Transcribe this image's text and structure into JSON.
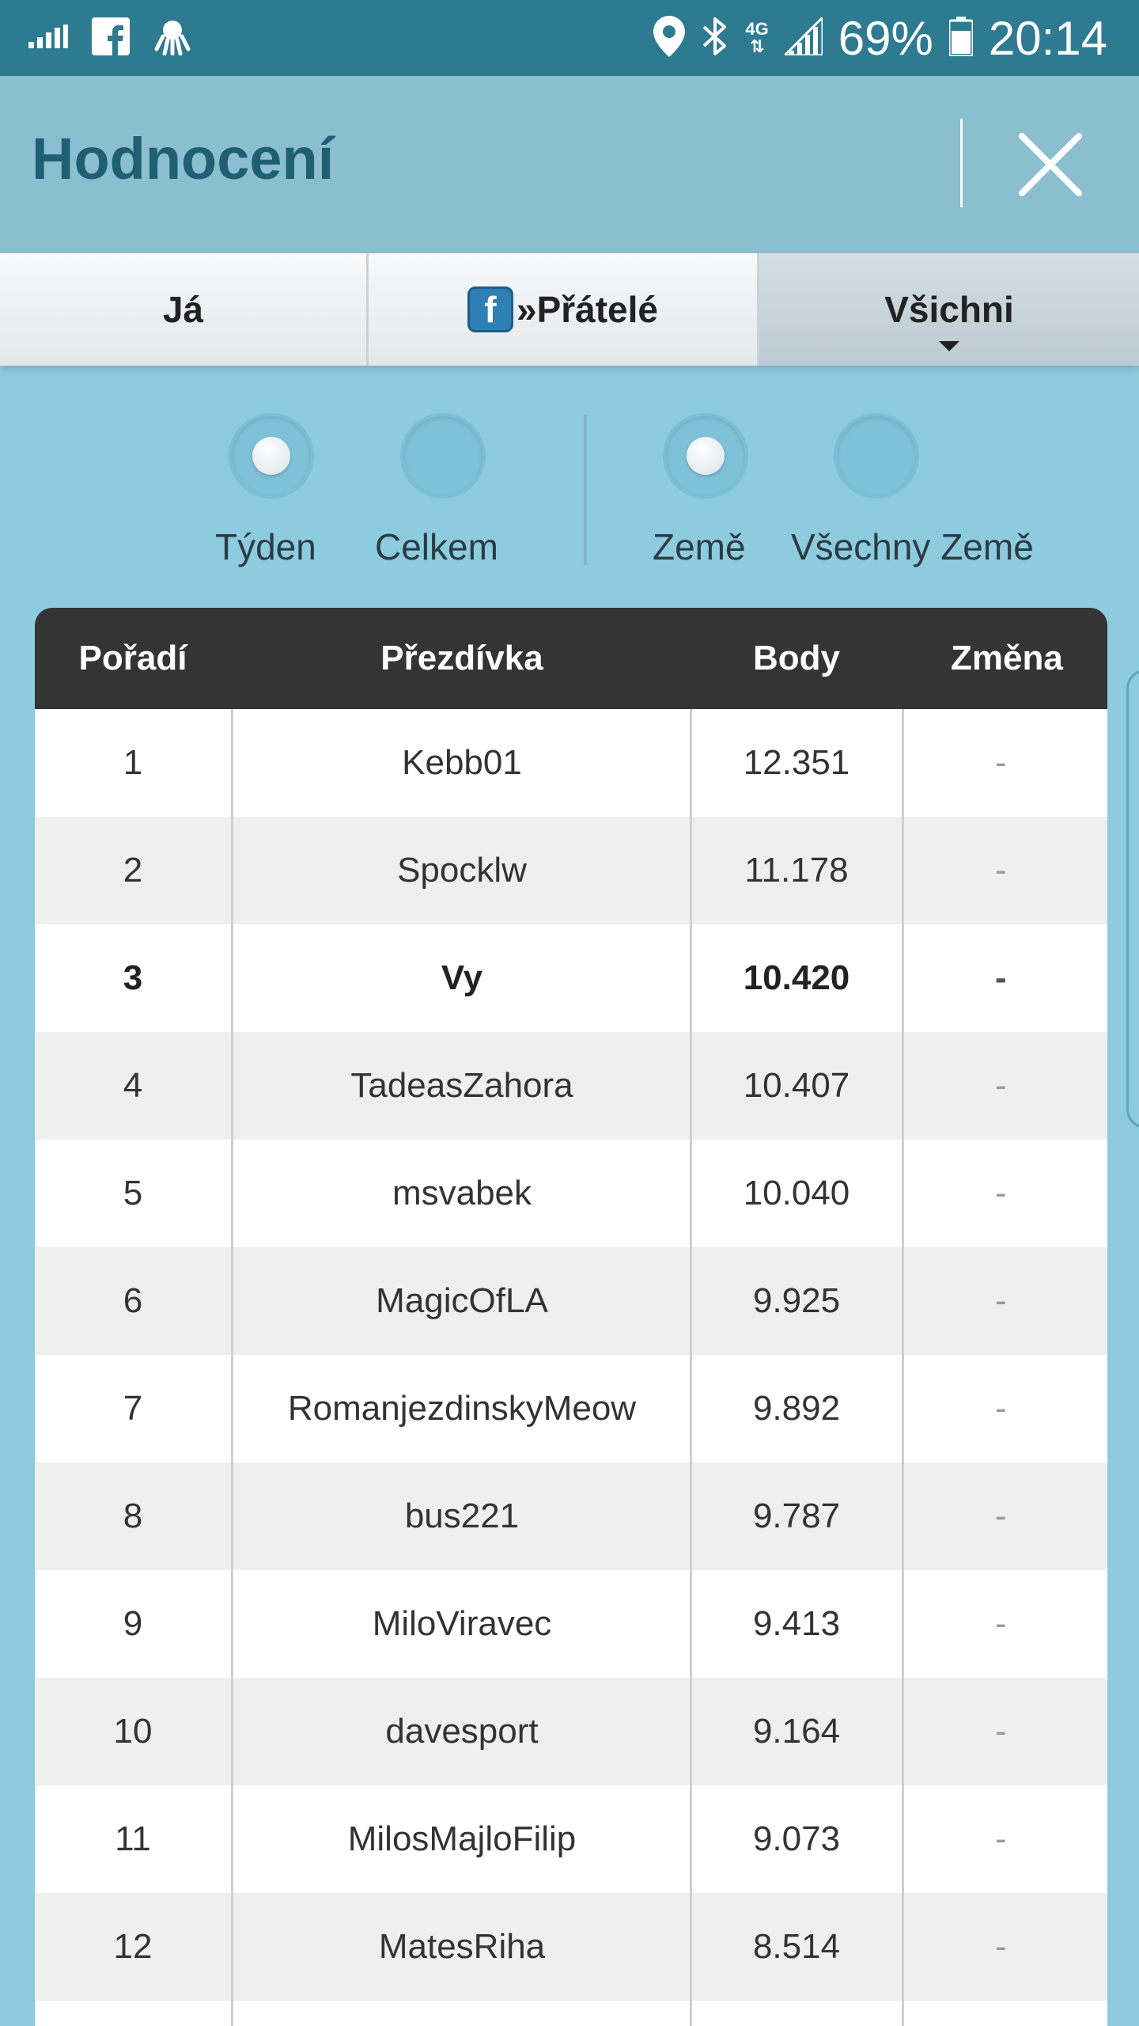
{
  "status_bar": {
    "battery": "69%",
    "time": "20:14",
    "network": "4G"
  },
  "header": {
    "title": "Hodnocení"
  },
  "tabs": [
    {
      "label": "Já"
    },
    {
      "label": "»Přátelé",
      "badge": "f"
    },
    {
      "label": "Všichni",
      "selected": true
    }
  ],
  "filters": {
    "period": [
      {
        "label": "Týden",
        "selected": true
      },
      {
        "label": "Celkem",
        "selected": false
      }
    ],
    "region": [
      {
        "label": "Země",
        "selected": true
      },
      {
        "label": "Všechny Země",
        "selected": false
      }
    ]
  },
  "table": {
    "headers": {
      "rank": "Pořadí",
      "nick": "Přezdívka",
      "points": "Body",
      "change": "Změna"
    },
    "rows": [
      {
        "rank": "1",
        "nick": "Kebb01",
        "points": "12.351",
        "change": "-"
      },
      {
        "rank": "2",
        "nick": "Spocklw",
        "points": "11.178",
        "change": "-"
      },
      {
        "rank": "3",
        "nick": "Vy",
        "points": "10.420",
        "change": "-",
        "is_me": true
      },
      {
        "rank": "4",
        "nick": "TadeasZahora",
        "points": "10.407",
        "change": "-"
      },
      {
        "rank": "5",
        "nick": "msvabek",
        "points": "10.040",
        "change": "-"
      },
      {
        "rank": "6",
        "nick": "MagicOfLA",
        "points": "9.925",
        "change": "-"
      },
      {
        "rank": "7",
        "nick": "RomanjezdinskyMeow",
        "points": "9.892",
        "change": "-"
      },
      {
        "rank": "8",
        "nick": "bus221",
        "points": "9.787",
        "change": "-"
      },
      {
        "rank": "9",
        "nick": "MiloViravec",
        "points": "9.413",
        "change": "-"
      },
      {
        "rank": "10",
        "nick": "davesport",
        "points": "9.164",
        "change": "-"
      },
      {
        "rank": "11",
        "nick": "MilosMajloFilip",
        "points": "9.073",
        "change": "-"
      },
      {
        "rank": "12",
        "nick": "MatesRiha",
        "points": "8.514",
        "change": "-"
      }
    ]
  },
  "colors": {
    "background": "#8dcbde",
    "status_bar": "#2e7b91",
    "header": "#8bbecf",
    "title": "#1e5f74",
    "table_header": "#343434"
  }
}
